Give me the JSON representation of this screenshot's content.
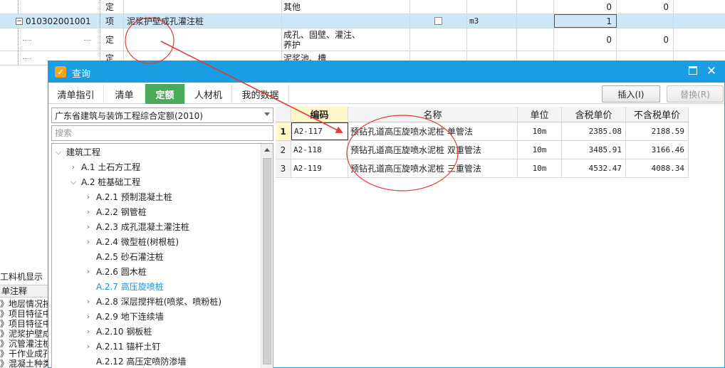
{
  "background_rows": [
    {
      "col2": "定",
      "col3": "",
      "col4": "其他",
      "col6": "",
      "col7": "",
      "col8": "0",
      "col9": "0"
    },
    {
      "code": "010302001001",
      "col2": "项",
      "col3": "泥浆护壁成孔灌注桩",
      "col4": "",
      "col6": "",
      "col7": "m3",
      "col8": "1",
      "col9": ""
    },
    {
      "col2": "定",
      "col3": "",
      "col4_line1": "成孔、固壁、灌注、",
      "col4_line2": "养护",
      "col6": "",
      "col7": "",
      "col8": "0",
      "col9": "0"
    },
    {
      "col2": "定",
      "col3": "",
      "col4": "泥浆池、槽",
      "col8": "",
      "col9": ""
    }
  ],
  "left_panel": {
    "title": "工料机显示",
    "header": "单注释",
    "items": [
      "》地层情况按",
      "》项目特征中",
      "》项目特征中",
      "》泥浆护壁成",
      "》沉管灌注桩",
      "》干作业成孔",
      "》混凝土种类"
    ]
  },
  "dialog": {
    "title": "查询",
    "tabs": [
      {
        "label": "清单指引",
        "active": false
      },
      {
        "label": "清单",
        "active": false
      },
      {
        "label": "定额",
        "active": true
      },
      {
        "label": "人材机",
        "active": false
      },
      {
        "label": "我的数据",
        "active": false
      }
    ],
    "insert_button": "插入(I)",
    "replace_button": "替换(R)",
    "library_selected": "广东省建筑与装饰工程综合定额(2010)",
    "search_placeholder": "搜索",
    "tree": [
      {
        "label": "建筑工程",
        "level": 0,
        "arrow": "down"
      },
      {
        "label": "A.1 土石方工程",
        "level": 1,
        "arrow": "right"
      },
      {
        "label": "A.2 桩基础工程",
        "level": 1,
        "arrow": "down"
      },
      {
        "label": "A.2.1 预制混凝土桩",
        "level": 2,
        "arrow": "right"
      },
      {
        "label": "A.2.2 钢管桩",
        "level": 2,
        "arrow": "right"
      },
      {
        "label": "A.2.3 成孔混凝土灌注桩",
        "level": 2,
        "arrow": "right"
      },
      {
        "label": "A.2.4 微型桩(树根桩)",
        "level": 2,
        "arrow": "right"
      },
      {
        "label": "A.2.5 砂石灌注桩",
        "level": 2,
        "arrow": ""
      },
      {
        "label": "A.2.6 圆木桩",
        "level": 2,
        "arrow": "right"
      },
      {
        "label": "A.2.7 高压旋喷桩",
        "level": 2,
        "arrow": "",
        "active": true
      },
      {
        "label": "A.2.8 深层搅拌桩(喷浆、喷粉桩)",
        "level": 2,
        "arrow": "right"
      },
      {
        "label": "A.2.9 地下连续墙",
        "level": 2,
        "arrow": "right"
      },
      {
        "label": "A.2.10 钢板桩",
        "level": 2,
        "arrow": "right"
      },
      {
        "label": "A.2.11 锚杆土钉",
        "level": 2,
        "arrow": "right"
      },
      {
        "label": "A.2.12 高压定喷防渗墙",
        "level": 2,
        "arrow": ""
      }
    ],
    "table": {
      "headers": {
        "code": "编码",
        "name": "名称",
        "unit": "单位",
        "tax_price": "含税单价",
        "notax_price": "不含税单价"
      },
      "rows": [
        {
          "index": "1",
          "code": "A2-117",
          "name": "预钻孔道高压旋喷水泥桩 单管法",
          "unit": "10m",
          "tax_price": "2385.08",
          "notax_price": "2188.59"
        },
        {
          "index": "2",
          "code": "A2-118",
          "name": "预钻孔道高压旋喷水泥桩 双重管法",
          "unit": "10m",
          "tax_price": "3485.91",
          "notax_price": "3166.46"
        },
        {
          "index": "3",
          "code": "A2-119",
          "name": "预钻孔道高压旋喷水泥桩 三重管法",
          "unit": "10m",
          "tax_price": "4532.47",
          "notax_price": "4088.34"
        }
      ]
    }
  },
  "colors": {
    "titlebar": "#1a9ee3",
    "active_tab": "#4aaa5a",
    "annotation": "#e53935",
    "selected_row": "#cfe8f7"
  }
}
